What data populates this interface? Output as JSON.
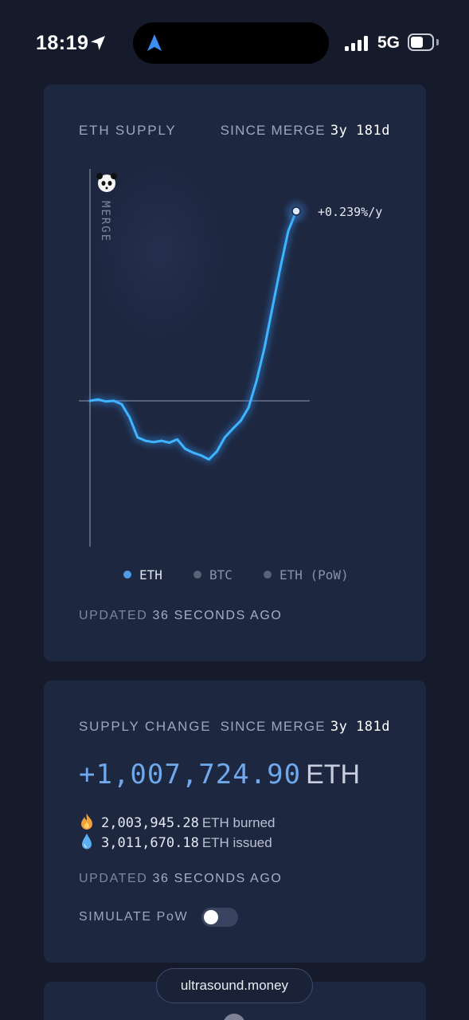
{
  "status_bar": {
    "time": "18:19",
    "network": "5G",
    "signal_bars": 4,
    "battery_level": 0.55
  },
  "supply_card": {
    "title": "ETH SUPPLY",
    "since_label": "SINCE MERGE",
    "since_value": "3y 181d",
    "merge_label": "MERGE",
    "rate": "+0.239%/y",
    "legend": [
      {
        "label": "ETH",
        "color": "#4f9be6",
        "active": true
      },
      {
        "label": "BTC",
        "color": "#5c6275",
        "active": false
      },
      {
        "label": "ETH (PoW)",
        "color": "#5c6275",
        "active": false
      }
    ],
    "updated_prefix": "UPDATED",
    "updated_num": "36",
    "updated_suffix": "SECONDS AGO"
  },
  "chart_data": {
    "type": "line",
    "title": "ETH SUPPLY",
    "xlabel": "",
    "ylabel": "",
    "annotations": [
      "MERGE",
      "+0.239%/y"
    ],
    "grid": false,
    "series": [
      {
        "name": "ETH",
        "color": "#3fb4ff",
        "values": [
          0.0,
          0.02,
          -0.01,
          0.0,
          -0.05,
          -0.25,
          -0.55,
          -0.6,
          -0.62,
          -0.6,
          -0.63,
          -0.58,
          -0.72,
          -0.78,
          -0.82,
          -0.88,
          -0.76,
          -0.55,
          -0.42,
          -0.3,
          -0.1,
          0.3,
          0.8,
          1.4,
          2.0,
          2.55,
          2.85
        ]
      }
    ],
    "x": [
      0,
      1,
      2,
      3,
      4,
      5,
      6,
      7,
      8,
      9,
      10,
      11,
      12,
      13,
      14,
      15,
      16,
      17,
      18,
      19,
      20,
      21,
      22,
      23,
      24,
      25,
      26
    ]
  },
  "change_card": {
    "title": "SUPPLY CHANGE",
    "since_label": "SINCE MERGE",
    "since_value": "3y 181d",
    "amount": "+1,007,724.90",
    "unit": "ETH",
    "burned_value": "2,003,945.28",
    "burned_label": "ETH burned",
    "issued_value": "3,011,670.18",
    "issued_label": "ETH issued",
    "updated_prefix": "UPDATED",
    "updated_num": "36",
    "updated_suffix": "SECONDS AGO",
    "simulate_label": "SIMULATE PoW",
    "simulate_on": false
  },
  "site_pill": "ultrasound.money"
}
